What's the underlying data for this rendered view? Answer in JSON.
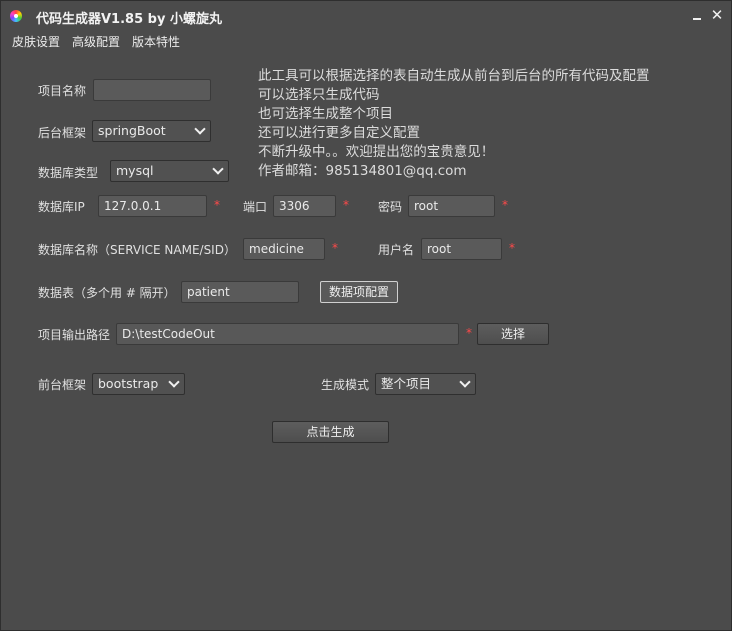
{
  "window": {
    "title": "代码生成器V1.85 by 小螺旋丸"
  },
  "menu": [
    "皮肤设置",
    "高级配置",
    "版本特性"
  ],
  "info_lines": [
    "此工具可以根据选择的表自动生成从前台到后台的所有代码及配置",
    "可以选择只生成代码",
    "也可选择生成整个项目",
    "还可以进行更多自定义配置",
    "不断升级中。。欢迎提出您的宝贵意见！",
    "作者邮箱：985134801@qq.com"
  ],
  "form": {
    "project_name": {
      "label": "项目名称",
      "value": ""
    },
    "backend_framework": {
      "label": "后台框架",
      "value": "springBoot"
    },
    "db_type": {
      "label": "数据库类型",
      "value": "mysql"
    },
    "db_ip": {
      "label": "数据库IP",
      "value": "127.0.0.1"
    },
    "port": {
      "label": "端口",
      "value": "3306"
    },
    "password": {
      "label": "密码",
      "value": "root"
    },
    "db_name": {
      "label": "数据库名称（SERVICE NAME/SID）",
      "value": "medicine"
    },
    "username": {
      "label": "用户名",
      "value": "root"
    },
    "tables": {
      "label": "数据表（多个用 # 隔开）",
      "value": "patient"
    },
    "data_config_button": "数据项配置",
    "output_path": {
      "label": "项目输出路径",
      "value": "D:\\testCodeOut"
    },
    "choose_button": "选择",
    "frontend_framework": {
      "label": "前台框架",
      "value": "bootstrap"
    },
    "gen_mode": {
      "label": "生成模式",
      "value": "整个项目"
    },
    "generate_button": "点击生成",
    "required_mark": "*"
  }
}
